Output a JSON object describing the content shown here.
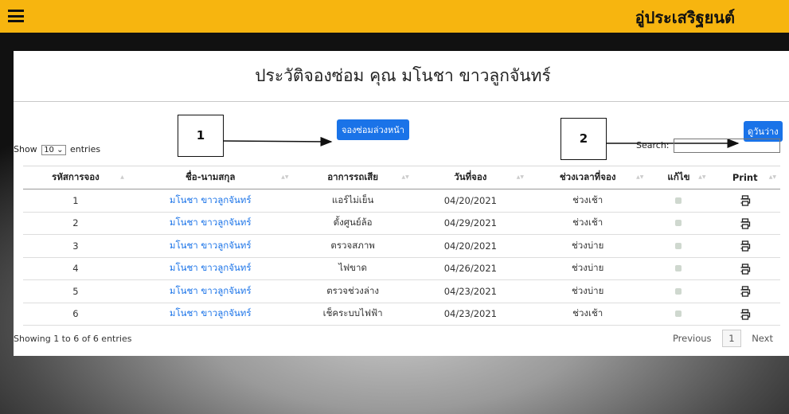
{
  "header": {
    "brand": "อู่ประเสริฐยนต์",
    "menu_icon": "hamburger-menu-icon"
  },
  "page": {
    "title": "ประวัติจองซ่อม คุณ มโนชา ขาวลูกจันทร์"
  },
  "buttons": {
    "book": "จองซ่อมล่วงหน้า",
    "free_days": "ดูวันว่าง"
  },
  "callouts": [
    "1",
    "2"
  ],
  "length": {
    "show": "Show",
    "value": "10",
    "entries": "entries"
  },
  "search": {
    "label": "Search:"
  },
  "table": {
    "headers": [
      "รหัสการจอง",
      "ชื่อ-นามสกุล",
      "อาการรถเสีย",
      "วันที่จอง",
      "ช่วงเวลาที่จอง",
      "แก้ไข",
      "Print"
    ],
    "rows": [
      [
        "1",
        "มโนชา ขาวลูกจันทร์",
        "แอร์ไม่เย็น",
        "04/20/2021",
        "ช่วงเช้า"
      ],
      [
        "2",
        "มโนชา ขาวลูกจันทร์",
        "ตั้งศูนย์ล้อ",
        "04/29/2021",
        "ช่วงเช้า"
      ],
      [
        "3",
        "มโนชา ขาวลูกจันทร์",
        "ตรวจสภาพ",
        "04/20/2021",
        "ช่วงบ่าย"
      ],
      [
        "4",
        "มโนชา ขาวลูกจันทร์",
        "ไฟขาด",
        "04/26/2021",
        "ช่วงบ่าย"
      ],
      [
        "5",
        "มโนชา ขาวลูกจันทร์",
        "ตรวจช่วงล่าง",
        "04/23/2021",
        "ช่วงบ่าย"
      ],
      [
        "6",
        "มโนชา ขาวลูกจันทร์",
        "เช็คระบบไฟฟ้า",
        "04/23/2021",
        "ช่วงเช้า"
      ]
    ],
    "edit_icon": "edit-icon",
    "print_icon": "printer-icon"
  },
  "info": "Showing 1 to 6 of 6 entries",
  "pagination": {
    "previous": "Previous",
    "current": "1",
    "next": "Next"
  },
  "colors": {
    "topbar": "#f7b50f",
    "accent": "#1a73e8"
  }
}
